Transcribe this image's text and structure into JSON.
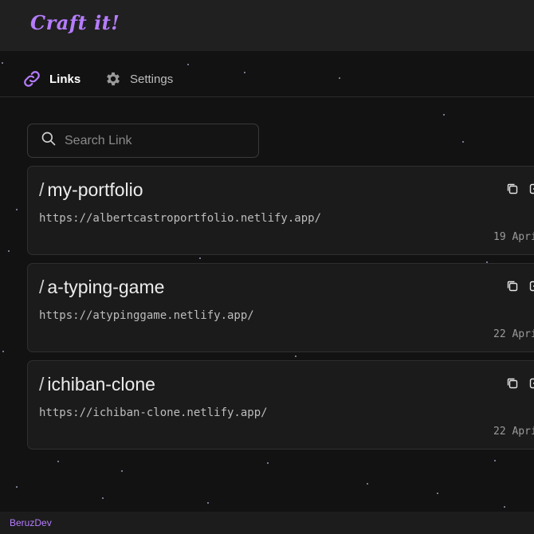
{
  "header": {
    "logo_text": "Craft it!"
  },
  "nav": {
    "items": [
      {
        "label": "Links",
        "icon": "link-icon",
        "active": true
      },
      {
        "label": "Settings",
        "icon": "gear-icon",
        "active": false
      }
    ]
  },
  "search": {
    "placeholder": "Search Link",
    "value": ""
  },
  "links": [
    {
      "slug": "my-portfolio",
      "url": "https://albertcastroportfolio.netlify.app/",
      "date": "19 Apri"
    },
    {
      "slug": "a-typing-game",
      "url": "https://atypinggame.netlify.app/",
      "date": "22 Apri"
    },
    {
      "slug": "ichiban-clone",
      "url": "https://ichiban-clone.netlify.app/",
      "date": "22 Apri"
    }
  ],
  "footer": {
    "text": "BeruzDev"
  },
  "colors": {
    "accent": "#b67cff",
    "background": "#121212",
    "card": "#1b1b1b"
  }
}
